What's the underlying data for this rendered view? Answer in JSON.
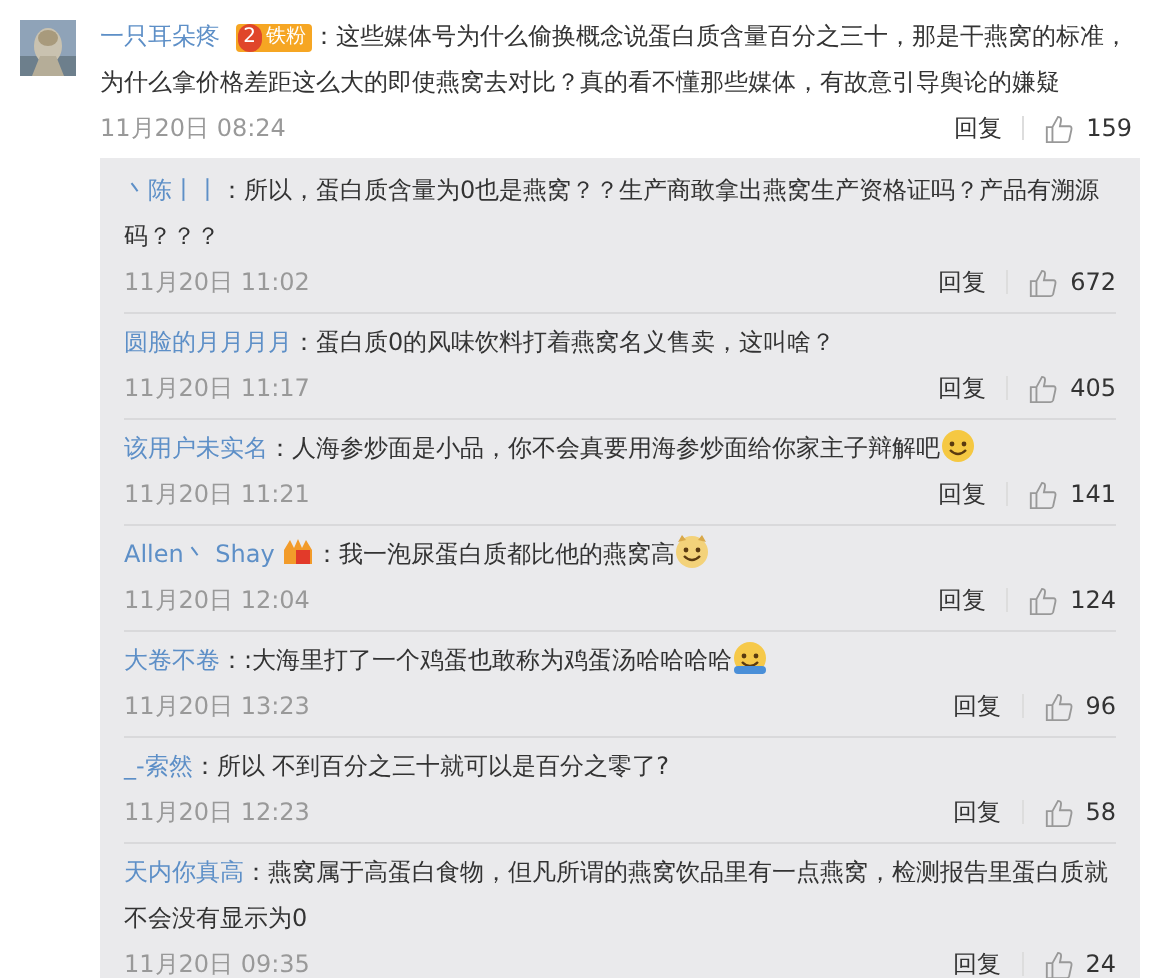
{
  "comment": {
    "user": "一只耳朵疼",
    "badge": {
      "level": "2",
      "label": "铁粉"
    },
    "text": "：这些媒体号为什么偷换概念说蛋白质含量百分之三十，那是干燕窝的标准，为什么拿价格差距这么大的即使燕窝去对比？真的看不懂那些媒体，有故意引导舆论的嫌疑",
    "time": "11月20日 08:24",
    "reply": "回复",
    "likes": "159"
  },
  "replies": [
    {
      "kind": "plain",
      "user": "丶陈丨丨",
      "text": "：所以，蛋白质含量为0也是燕窝？？生产商敢拿出燕窝生产资格证吗？产品有溯源码？？？",
      "time": "11月20日 11:02",
      "reply": "回复",
      "likes": "672"
    },
    {
      "kind": "plain",
      "user": "圆脸的月月月月",
      "text": "：蛋白质0的风味饮料打着燕窝名义售卖，这叫啥？",
      "time": "11月20日 11:17",
      "reply": "回复",
      "likes": "405"
    },
    {
      "kind": "grin",
      "user": "该用户未实名",
      "text": "：人海参炒面是小品，你不会真要用海参炒面给你家主子辩解吧",
      "time": "11月20日 11:21",
      "reply": "回复",
      "likes": "141"
    },
    {
      "kind": "dog",
      "user": "Allen丶 Shay",
      "badge_icon": true,
      "text": "：我一泡尿蛋白质都比他的燕窝高",
      "time": "11月20日 12:04",
      "reply": "回复",
      "likes": "124"
    },
    {
      "kind": "hug",
      "user": "大卷不卷",
      "text": "：:大海里打了一个鸡蛋也敢称为鸡蛋汤哈哈哈哈",
      "time": "11月20日 13:23",
      "reply": "回复",
      "likes": "96"
    },
    {
      "kind": "plain",
      "user": "_-索然",
      "text": "：所以 不到百分之三十就可以是百分之零了?",
      "time": "11月20日 12:23",
      "reply": "回复",
      "likes": "58"
    },
    {
      "kind": "plain",
      "user": "天内你真高",
      "text": "：燕窝属于高蛋白食物，但凡所谓的燕窝饮品里有一点燕窝，检测报告里蛋白质就不会没有显示为0",
      "time": "11月20日 09:35",
      "reply": "回复",
      "likes": "24"
    }
  ]
}
